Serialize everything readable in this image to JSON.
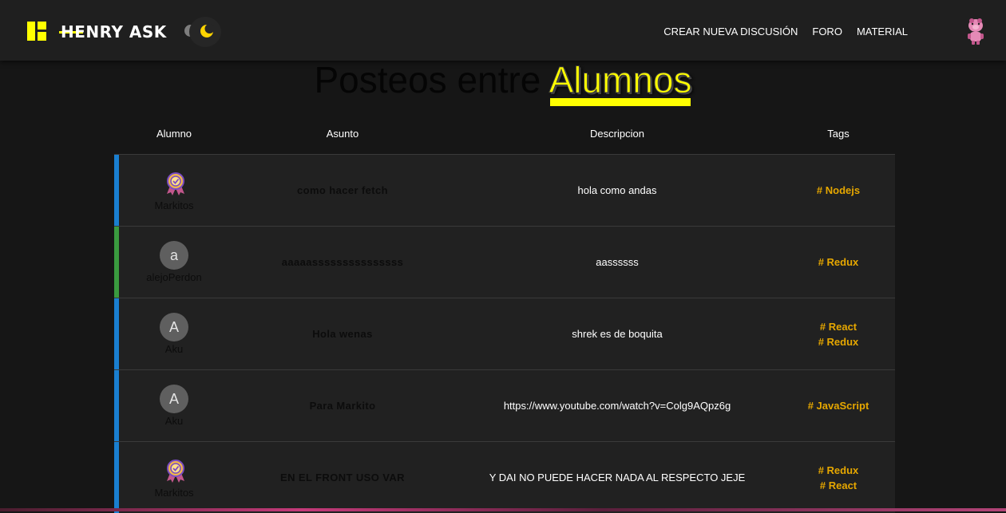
{
  "app": {
    "brand": "HENRY ASK",
    "accent_color": "#ffff01",
    "theme_toggle": "moon-icon"
  },
  "nav": {
    "links": [
      {
        "label": "CREAR NUEVA DISCUSIÓN"
      },
      {
        "label": "FORO"
      },
      {
        "label": "MATERIAL"
      }
    ],
    "avatar": "pig-avatar-icon"
  },
  "page": {
    "title_prefix": "Posteos entre",
    "title_accent": "Alumnos"
  },
  "table": {
    "columns": [
      "Alumno",
      "Asunto",
      "Descripcion",
      "Tags"
    ],
    "rows": [
      {
        "stripe": "#1a7fd0",
        "avatar": "badge",
        "user": "Markitos",
        "subject": "como hacer fetch",
        "description": "hola como andas",
        "tags": [
          "# Nodejs"
        ]
      },
      {
        "stripe": "#3a9a3f",
        "avatar": "a",
        "user": "alejoPerdon",
        "subject": "aaaaasssssssssssssss",
        "description": "aassssss",
        "tags": [
          "# Redux"
        ]
      },
      {
        "stripe": "#1a7fd0",
        "avatar": "A",
        "user": "Aku",
        "subject": "Hola wenas",
        "description": "shrek es de boquita",
        "tags": [
          "# React",
          "# Redux"
        ]
      },
      {
        "stripe": "#1a7fd0",
        "avatar": "A",
        "user": "Aku",
        "subject": "Para Markito",
        "description": "https://www.youtube.com/watch?v=Colg9AQpz6g",
        "tags": [
          "# JavaScript"
        ]
      },
      {
        "stripe": "#1a7fd0",
        "avatar": "badge",
        "user": "Markitos",
        "subject": "EN EL FRONT USO VAR",
        "description": "Y DAI NO PUEDE HACER NADA AL RESPECTO JEJE",
        "tags": [
          "# Redux",
          "# React"
        ]
      }
    ]
  }
}
